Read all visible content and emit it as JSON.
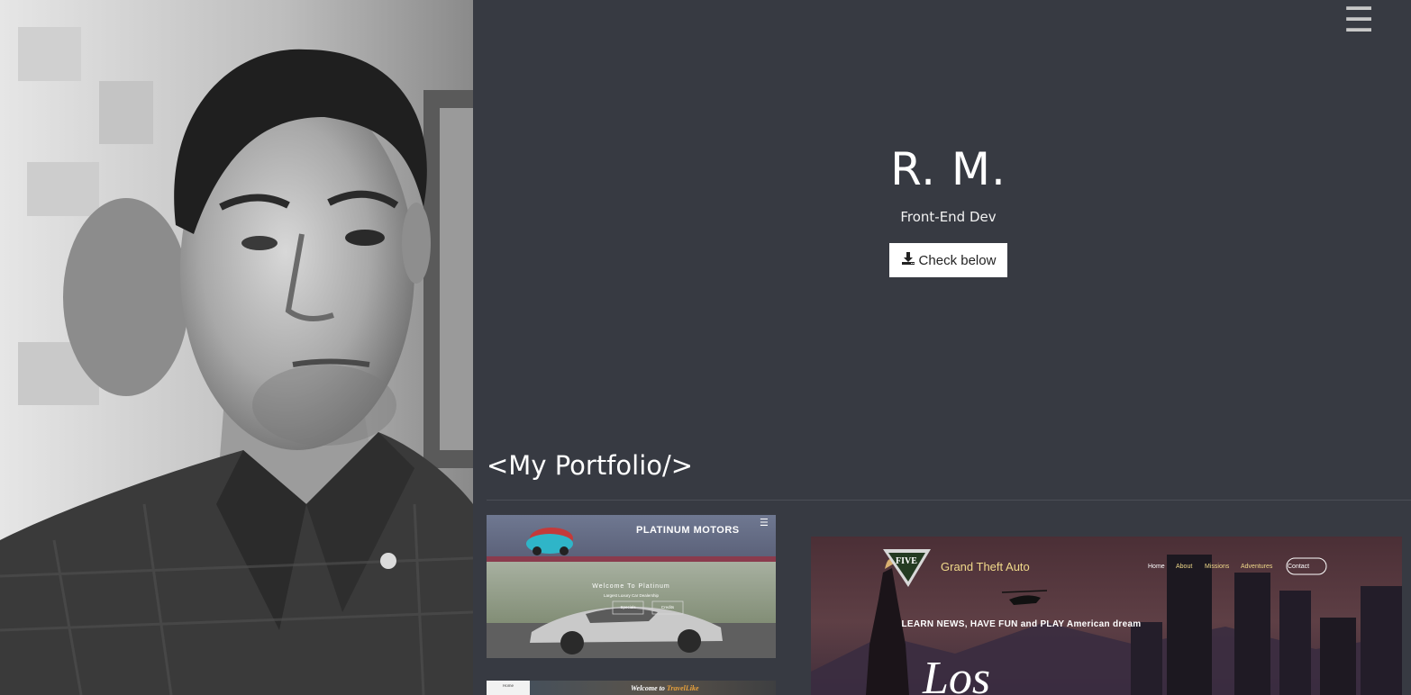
{
  "header": {
    "menu_icon": "hamburger-menu-icon",
    "menu_glyph": "☰"
  },
  "hero": {
    "name": "R. M.",
    "role": "Front-End Dev",
    "button_label": "Check below",
    "button_icon": "download-icon"
  },
  "portfolio": {
    "title": "<My Portfolio/>",
    "items": [
      {
        "title": "PLATINUM MOTORS",
        "welcome": "Welcome To Platinum",
        "tagline": "Largest Luxury Car Dealership",
        "buttons": [
          "Specials",
          "Credits"
        ]
      },
      {
        "title_prefix": "Welcome to",
        "title_brand": "TravelLike",
        "nav_label": "Home"
      },
      {
        "logo_text": "FIVE",
        "title": "Grand Theft Auto",
        "nav": [
          "Home",
          "About",
          "Missions",
          "Adventures",
          "Contact"
        ],
        "headline": "LEARN NEWS, HAVE FUN and PLAY American dream",
        "big_text": "Los"
      }
    ]
  },
  "colors": {
    "background": "#373a42",
    "text": "#ffffff",
    "button_bg": "#ffffff",
    "gta_accent": "#f0d98a"
  }
}
